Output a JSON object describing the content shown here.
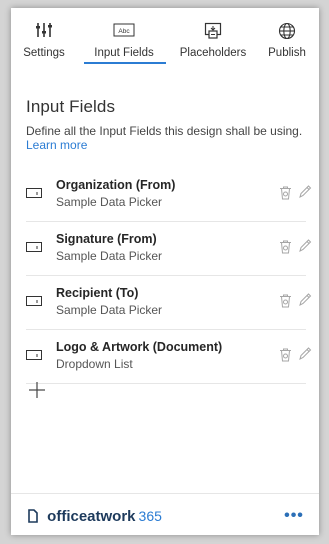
{
  "tabs": [
    {
      "label": "Settings",
      "icon": "sliders-icon"
    },
    {
      "label": "Input Fields",
      "icon": "input-box-icon",
      "icon_text": "Abc",
      "active": true
    },
    {
      "label": "Placeholders",
      "icon": "placeholder-icon"
    },
    {
      "label": "Publish",
      "icon": "globe-icon"
    }
  ],
  "main": {
    "title": "Input Fields",
    "description": "Define all the Input Fields this design shall be using.",
    "learn_more": "Learn more",
    "fields": [
      {
        "name": "Organization (From)",
        "type": "Sample Data Picker"
      },
      {
        "name": "Signature (From)",
        "type": "Sample Data Picker"
      },
      {
        "name": "Recipient (To)",
        "type": "Sample Data Picker"
      },
      {
        "name": "Logo & Artwork (Document)",
        "type": "Dropdown List"
      }
    ],
    "add_label": "+"
  },
  "footer": {
    "brand": "officeatwork",
    "version": "365",
    "more": "•••"
  },
  "colors": {
    "accent": "#2b7cd3",
    "brand": "#1d3a5c"
  }
}
